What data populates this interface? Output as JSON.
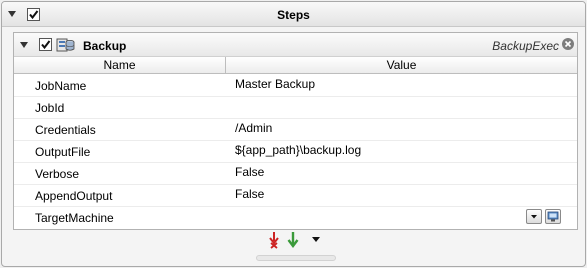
{
  "panel": {
    "title": "Steps",
    "enabled": true
  },
  "step": {
    "title": "Backup",
    "type": "BackupExec",
    "enabled": true,
    "icon": "backup-exec-icon"
  },
  "grid": {
    "columns": {
      "name": "Name",
      "value": "Value"
    },
    "rows": [
      {
        "name": "JobName",
        "value": "Master Backup"
      },
      {
        "name": "JobId",
        "value": ""
      },
      {
        "name": "Credentials",
        "value": "/Admin"
      },
      {
        "name": "OutputFile",
        "value": "${app_path}\\backup.log"
      },
      {
        "name": "Verbose",
        "value": "False"
      },
      {
        "name": "AppendOutput",
        "value": "False"
      },
      {
        "name": "TargetMachine",
        "value": ""
      }
    ]
  },
  "toolbar": {
    "icons": [
      "remove-step-icon",
      "add-step-icon",
      "dropdown-arrow-icon"
    ]
  },
  "colors": {
    "header_gradient_top": "#f9f9f9",
    "header_gradient_bottom": "#e3e3e3",
    "border": "#a9a9a9",
    "remove_icon": "#cc2222",
    "add_icon": "#3a9a3a"
  }
}
